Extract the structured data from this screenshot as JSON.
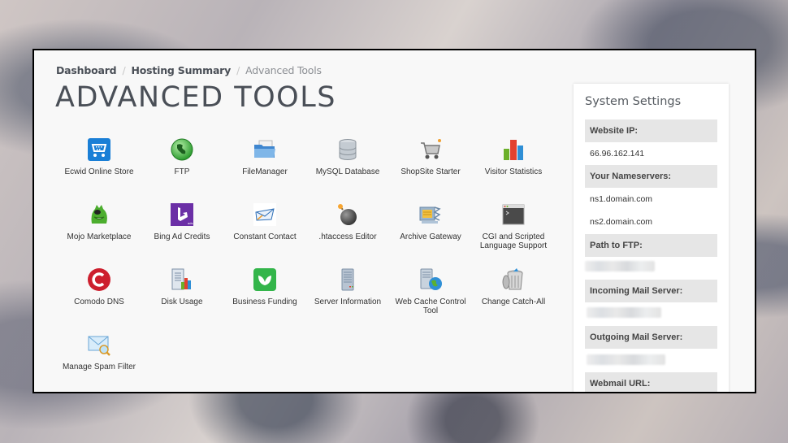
{
  "breadcrumb": {
    "items": [
      "Dashboard",
      "Hosting Summary"
    ],
    "current": "Advanced Tools",
    "separator": "/"
  },
  "page_title": "ADVANCED TOOLS",
  "tools": [
    {
      "label": "Ecwid Online Store",
      "icon": "cart-icon"
    },
    {
      "label": "FTP",
      "icon": "globe-icon"
    },
    {
      "label": "FileManager",
      "icon": "folder-icon"
    },
    {
      "label": "MySQL Database",
      "icon": "database-icon"
    },
    {
      "label": "ShopSite Starter",
      "icon": "shopping-cart-icon"
    },
    {
      "label": "Visitor Statistics",
      "icon": "bar-chart-icon"
    },
    {
      "label": "Mojo Marketplace",
      "icon": "mojo-monster-icon"
    },
    {
      "label": "Bing Ad Credits",
      "icon": "bing-ads-icon"
    },
    {
      "label": "Constant Contact",
      "icon": "envelope-check-icon"
    },
    {
      "label": ".htaccess Editor",
      "icon": "bomb-icon"
    },
    {
      "label": "Archive Gateway",
      "icon": "archive-icon"
    },
    {
      "label": "CGI and Scripted Language Support",
      "icon": "terminal-icon"
    },
    {
      "label": "Comodo DNS",
      "icon": "comodo-icon"
    },
    {
      "label": "Disk Usage",
      "icon": "disk-usage-icon"
    },
    {
      "label": "Business Funding",
      "icon": "leaf-icon"
    },
    {
      "label": "Server Information",
      "icon": "server-icon"
    },
    {
      "label": "Web Cache Control Tool",
      "icon": "server-globe-icon"
    },
    {
      "label": "Change Catch-All",
      "icon": "trash-can-icon"
    },
    {
      "label": "Manage Spam Filter",
      "icon": "envelope-search-icon"
    }
  ],
  "system_settings": {
    "title": "System Settings",
    "website_ip_label": "Website IP:",
    "website_ip": "66.96.162.141",
    "nameservers_label": "Your Nameservers:",
    "nameservers": [
      "ns1.domain.com",
      "ns2.domain.com"
    ],
    "ftp_path_label": "Path to FTP:",
    "incoming_mail_label": "Incoming Mail Server:",
    "outgoing_mail_label": "Outgoing Mail Server:",
    "webmail_url_label": "Webmail URL:"
  }
}
